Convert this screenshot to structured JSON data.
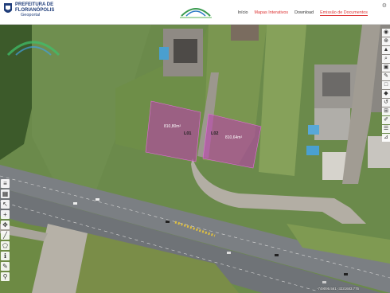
{
  "header": {
    "brand_line1": "PREFEITURA DE",
    "brand_line2": "FLORIANÓPOLIS",
    "geoportal": "Geoportal",
    "nav": [
      {
        "label": "Início",
        "style": "plain"
      },
      {
        "label": "Mapas Interativos",
        "style": "hl"
      },
      {
        "label": "Download",
        "style": "plain"
      },
      {
        "label": "Emissão de Documentos",
        "style": "active"
      }
    ],
    "brand_color": "#1f3d7a",
    "accent_color": "#dd3333",
    "settings_icon": "gear-icon"
  },
  "map": {
    "lots": [
      {
        "label": "L01",
        "area": "810,80m²"
      },
      {
        "label": "L02",
        "area": "810,64m²"
      }
    ],
    "lot_fill": "#c13bb5",
    "coordinates": "-749095.561,-3221683.775"
  },
  "left_tools": [
    "layers-icon",
    "grid-icon",
    "cursor-icon",
    "plus-icon",
    "pan-icon",
    "line-icon",
    "polygon-icon",
    "info-icon",
    "edit-icon",
    "pin-icon",
    "ruler-icon",
    "print-icon"
  ],
  "right_tools": [
    "globe-icon",
    "target-icon",
    "marker-icon",
    "zoom-icon",
    "lock-icon",
    "pen-icon",
    "square-icon",
    "tag-icon",
    "undo-icon",
    "measure-icon",
    "draw-icon",
    "list-icon",
    "ruler-icon"
  ]
}
